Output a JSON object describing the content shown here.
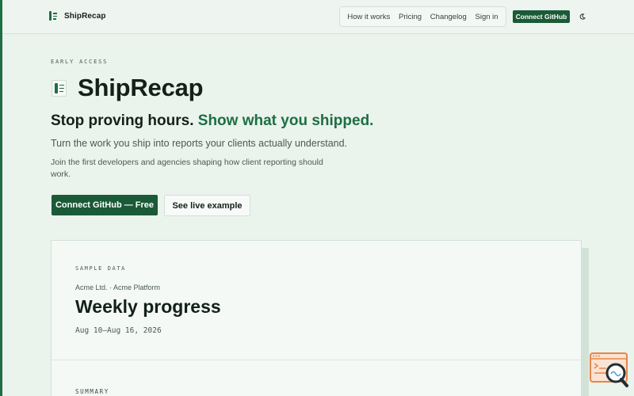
{
  "nav": {
    "brand": "ShipRecap",
    "links": [
      "How it works",
      "Pricing",
      "Changelog",
      "Sign in"
    ],
    "cta": "Connect GitHub",
    "theme_icon": "moon-icon"
  },
  "hero": {
    "eyebrow": "EARLY ACCESS",
    "title": "ShipRecap",
    "tagline_plain": "Stop proving hours.",
    "tagline_accent": "Show what you shipped.",
    "lead": "Turn the work you ship into reports your clients actually understand.",
    "sub": "Join the first developers and agencies shaping how client reporting should work.",
    "primary_button": "Connect GitHub — Free",
    "secondary_button": "See live example"
  },
  "sample_card": {
    "eyebrow": "SAMPLE DATA",
    "client": "Acme Ltd. · Acme Platform",
    "title": "Weekly progress",
    "dates": "Aug 10–Aug 16, 2026",
    "summary_label": "SUMMARY"
  },
  "colors": {
    "accent": "#1e6e44",
    "button": "#1a5a37",
    "background": "#eaf3ec",
    "widget": "#e8854a"
  },
  "widget_icon": "chat-search-icon"
}
